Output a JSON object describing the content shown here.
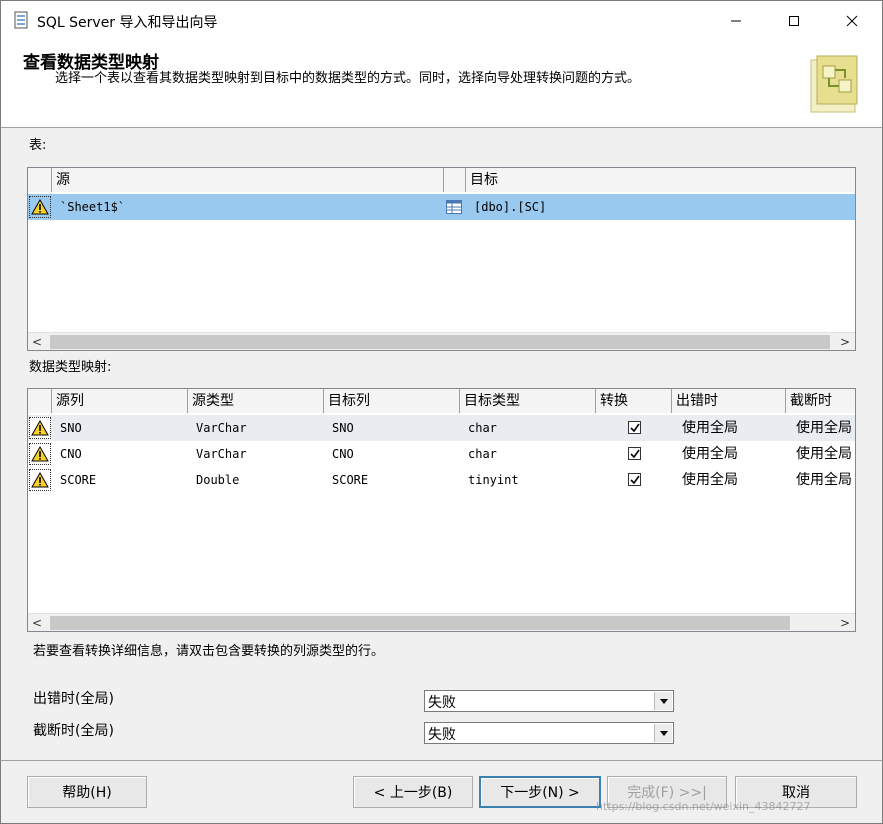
{
  "window": {
    "title": "SQL Server 导入和导出向导"
  },
  "header": {
    "title": "查看数据类型映射",
    "description": "选择一个表以查看其数据类型映射到目标中的数据类型的方式。同时，选择向导处理转换问题的方式。"
  },
  "tables_section": {
    "label": "表:",
    "columns": [
      "源",
      "目标"
    ],
    "rows": [
      {
        "source": "`Sheet1$`",
        "destination": "[dbo].[SC]"
      }
    ]
  },
  "mapping_section": {
    "label": "数据类型映射:",
    "columns": [
      "源列",
      "源类型",
      "目标列",
      "目标类型",
      "转换",
      "出错时",
      "截断时"
    ],
    "rows": [
      {
        "src_col": "SNO",
        "src_type": "VarChar",
        "dst_col": "SNO",
        "dst_type": "char",
        "convert": true,
        "on_error": "使用全局",
        "on_trunc": "使用全局"
      },
      {
        "src_col": "CNO",
        "src_type": "VarChar",
        "dst_col": "CNO",
        "dst_type": "char",
        "convert": true,
        "on_error": "使用全局",
        "on_trunc": "使用全局"
      },
      {
        "src_col": "SCORE",
        "src_type": "Double",
        "dst_col": "SCORE",
        "dst_type": "tinyint",
        "convert": true,
        "on_error": "使用全局",
        "on_trunc": "使用全局"
      }
    ]
  },
  "info_text": "若要查看转换详细信息，请双击包含要转换的列源类型的行。",
  "global_options": {
    "on_error_label": "出错时(全局)",
    "on_error_value": "失败",
    "on_trunc_label": "截断时(全局)",
    "on_trunc_value": "失败"
  },
  "footer": {
    "help": "帮助(H)",
    "back": "< 上一步(B)",
    "next": "下一步(N) >",
    "finish": "完成(F) >>|",
    "cancel": "取消"
  },
  "watermark": "https://blog.csdn.net/weixin_43842727"
}
